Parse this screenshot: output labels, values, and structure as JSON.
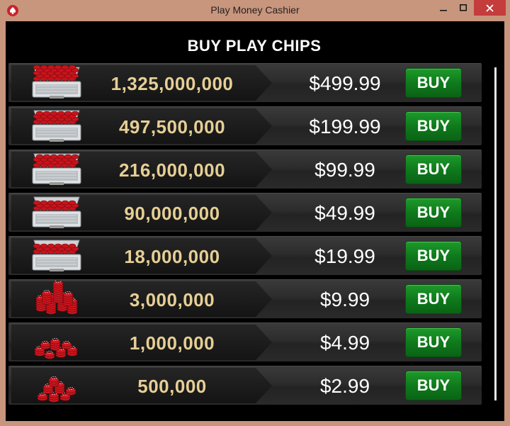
{
  "window": {
    "title": "Play Money Cashier"
  },
  "controls": {
    "minimize_icon": "minimize-icon",
    "maximize_icon": "maximize-icon",
    "close_icon": "close-icon"
  },
  "header": {
    "title": "BUY PLAY CHIPS"
  },
  "packages": [
    {
      "amount": "1,325,000,000",
      "price": "$499.99",
      "buy_label": "BUY",
      "icon": "chip-case-full-icon"
    },
    {
      "amount": "497,500,000",
      "price": "$199.99",
      "buy_label": "BUY",
      "icon": "chip-case-icon"
    },
    {
      "amount": "216,000,000",
      "price": "$99.99",
      "buy_label": "BUY",
      "icon": "chip-case-icon"
    },
    {
      "amount": "90,000,000",
      "price": "$49.99",
      "buy_label": "BUY",
      "icon": "chip-case-icon"
    },
    {
      "amount": "18,000,000",
      "price": "$19.99",
      "buy_label": "BUY",
      "icon": "chip-case-icon"
    },
    {
      "amount": "3,000,000",
      "price": "$9.99",
      "buy_label": "BUY",
      "icon": "chip-stacks-icon"
    },
    {
      "amount": "1,000,000",
      "price": "$4.99",
      "buy_label": "BUY",
      "icon": "chip-stacks-icon"
    },
    {
      "amount": "500,000",
      "price": "$2.99",
      "buy_label": "BUY",
      "icon": "chip-stack-icon"
    }
  ],
  "colors": {
    "accent": "#0f7a1c",
    "amount_text": "#e6cf95",
    "close_button": "#c53c3c"
  }
}
